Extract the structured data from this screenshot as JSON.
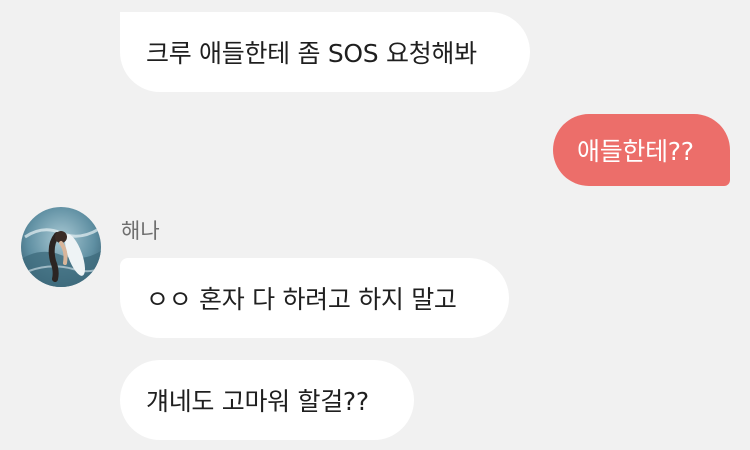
{
  "chat": {
    "messages": [
      {
        "direction": "incoming",
        "text": "크루 애들한테 좀 SOS 요청해봐"
      },
      {
        "direction": "outgoing",
        "text": "애들한테??"
      },
      {
        "direction": "incoming",
        "text": "ㅇㅇ 혼자 다 하려고 하지 말고"
      },
      {
        "direction": "incoming",
        "text": "걔네도 고마워 할걸??"
      }
    ],
    "sender": {
      "name": "해나",
      "avatar_icon": "profile-photo-surfer"
    }
  },
  "colors": {
    "background": "#f1f1f1",
    "incoming_bubble": "#ffffff",
    "outgoing_bubble": "#ec6e6a",
    "incoming_text": "#1f1f1f",
    "outgoing_text": "#ffffff",
    "sender_name": "#6f6f6f"
  }
}
